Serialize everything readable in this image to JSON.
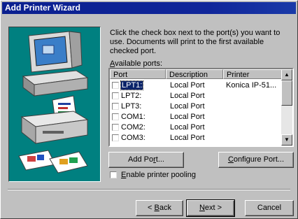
{
  "window": {
    "title": "Add Printer Wizard"
  },
  "instructions": "Click the check box next to the port(s) you want to use. Documents will print to the first available checked port.",
  "ports_label": {
    "prefix": "",
    "accel": "A",
    "rest": "vailable ports:"
  },
  "table": {
    "columns": [
      "Port",
      "Description",
      "Printer"
    ],
    "rows": [
      {
        "port": "LPT1:",
        "description": "Local Port",
        "printer": "Konica IP-51...",
        "checked": false,
        "selected": true
      },
      {
        "port": "LPT2:",
        "description": "Local Port",
        "printer": "",
        "checked": false,
        "selected": false
      },
      {
        "port": "LPT3:",
        "description": "Local Port",
        "printer": "",
        "checked": false,
        "selected": false
      },
      {
        "port": "COM1:",
        "description": "Local Port",
        "printer": "",
        "checked": false,
        "selected": false
      },
      {
        "port": "COM2:",
        "description": "Local Port",
        "printer": "",
        "checked": false,
        "selected": false
      },
      {
        "port": "COM3:",
        "description": "Local Port",
        "printer": "",
        "checked": false,
        "selected": false
      }
    ]
  },
  "buttons": {
    "add_port": {
      "prefix": "Add Po",
      "accel": "r",
      "rest": "t..."
    },
    "configure_port": {
      "prefix": "",
      "accel": "C",
      "rest": "onfigure Port..."
    },
    "back": {
      "prefix": "< ",
      "accel": "B",
      "rest": "ack"
    },
    "next": {
      "prefix": "",
      "accel": "N",
      "rest": "ext >"
    },
    "cancel": "Cancel"
  },
  "pooling": {
    "prefix": "",
    "accel": "E",
    "rest": "nable printer pooling",
    "checked": false
  },
  "icons": {
    "wizard_art": "computer-and-printer-illustration",
    "scroll_up": "scroll-up-arrow-icon",
    "scroll_down": "scroll-down-arrow-icon"
  }
}
